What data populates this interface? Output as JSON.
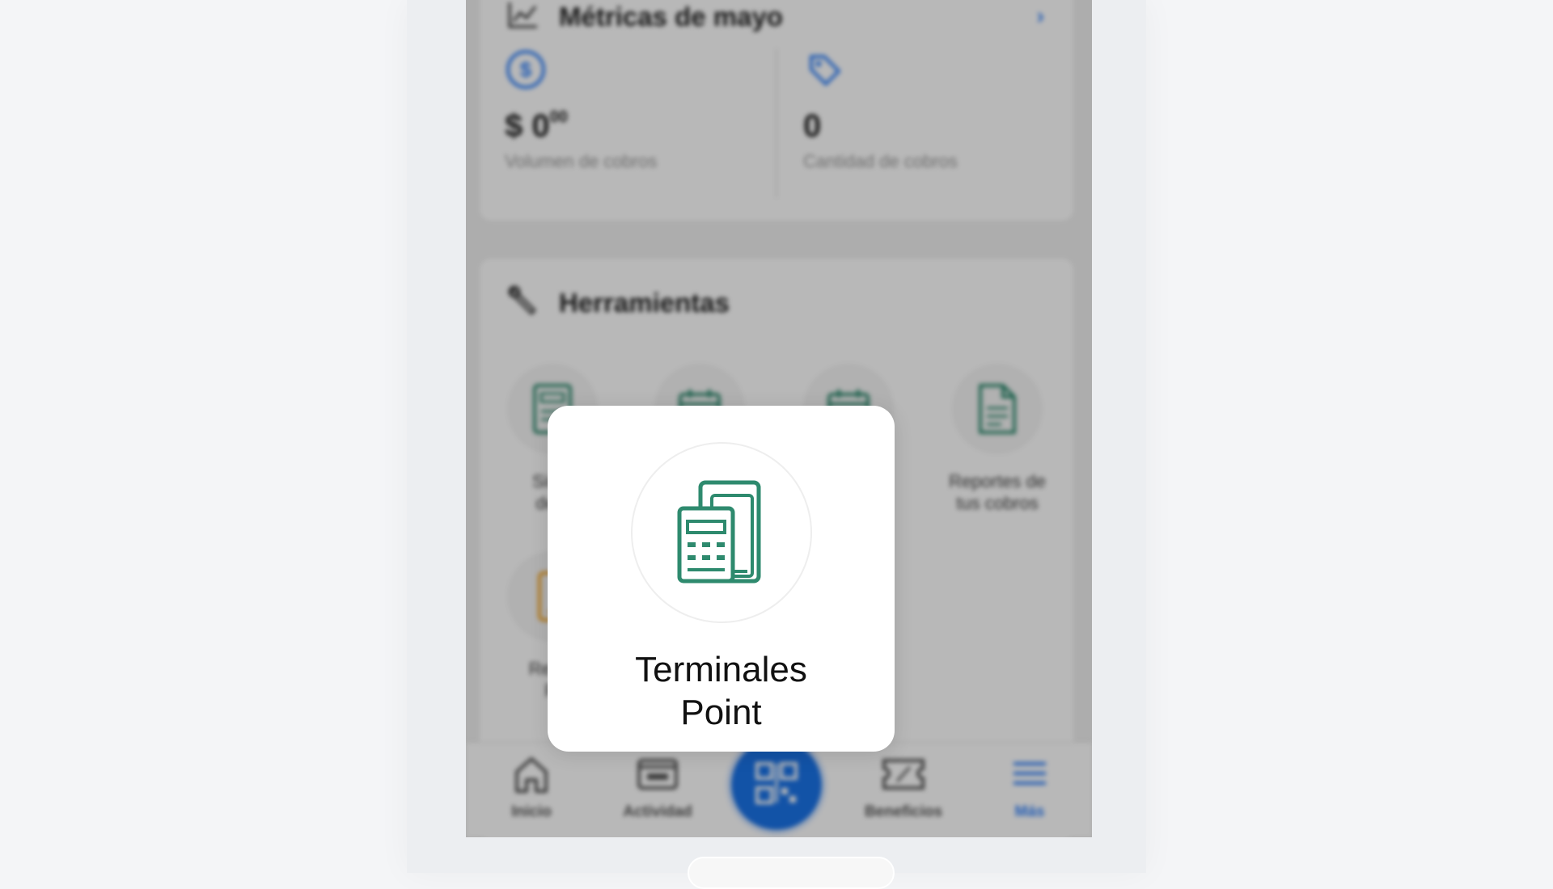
{
  "metrics": {
    "title": "Métricas de mayo",
    "chevron": "›",
    "volume": {
      "value": "$ 0",
      "cents": "00",
      "label": "Volumen de cobros"
    },
    "count": {
      "value": "0",
      "label": "Cantidad de cobros"
    }
  },
  "tools": {
    "title": "Herramientas",
    "items": [
      {
        "label_line1": "Simu",
        "label_line2": "de c"
      },
      {
        "label_line1": "",
        "label_line2": ""
      },
      {
        "label_line1": "",
        "label_line2": ""
      },
      {
        "label_line1": "Reportes de",
        "label_line2": "tus cobros"
      },
      {
        "label_line1": "Recor",
        "label_line2": "Pi"
      }
    ]
  },
  "bottom_nav": {
    "items": [
      {
        "label": "Inicio"
      },
      {
        "label": "Actividad"
      },
      {
        "label": "Beneficios"
      },
      {
        "label": "Más"
      }
    ],
    "active": "Más"
  },
  "popup": {
    "line1": "Terminales",
    "line2": "Point"
  },
  "colors": {
    "accent": "#3483fa",
    "tool_green": "#2e8a6e",
    "tool_orange": "#f5a623"
  }
}
